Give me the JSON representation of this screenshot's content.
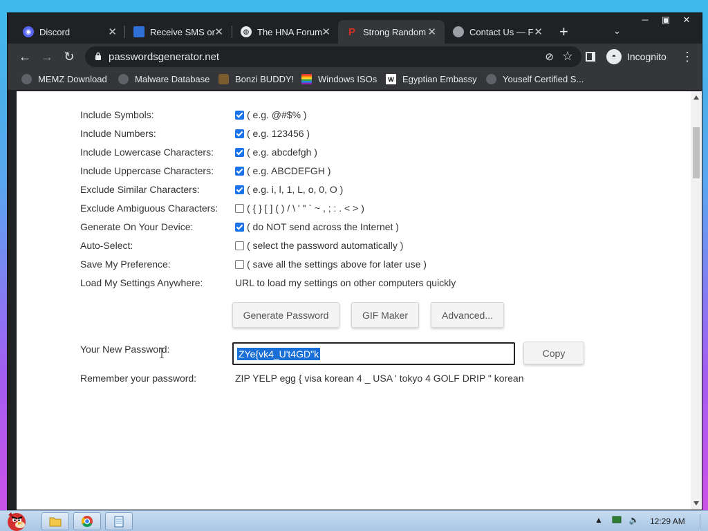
{
  "browser": {
    "tabs": [
      {
        "title": "Discord",
        "icon_color": "#5865f2",
        "icon": "discord-icon",
        "active": false
      },
      {
        "title": "Receive SMS or",
        "icon_color": "#2f6fd6",
        "icon": "sms-icon",
        "active": false
      },
      {
        "title": "The HNA Forum",
        "icon_color": "#e8eaed",
        "icon": "globe-icon",
        "active": false
      },
      {
        "title": "Strong Random",
        "icon_color": "#d93025",
        "icon": "password-icon",
        "active": true
      },
      {
        "title": "Contact Us — F",
        "icon_color": "#9aa0a6",
        "icon": "contact-icon",
        "active": false
      }
    ],
    "url": "passwordsgenerator.net",
    "profile_label": "Incognito",
    "bookmarks": [
      {
        "label": "MEMZ Download",
        "icon": "globe-icon"
      },
      {
        "label": "Malware Database",
        "icon": "globe-icon"
      },
      {
        "label": "Bonzi BUDDY!",
        "icon": "bonzi-icon"
      },
      {
        "label": "Windows ISOs",
        "icon": "rainbow-flag-icon"
      },
      {
        "label": "Egyptian Embassy",
        "icon": "wix-icon"
      },
      {
        "label": "Youself Certified S...",
        "icon": "globe-icon"
      }
    ]
  },
  "options": [
    {
      "label": "Include Symbols:",
      "checked": true,
      "hint": "( e.g. @#$% )"
    },
    {
      "label": "Include Numbers:",
      "checked": true,
      "hint": "( e.g. 123456 )"
    },
    {
      "label": "Include Lowercase Characters:",
      "checked": true,
      "hint": "( e.g. abcdefgh )"
    },
    {
      "label": "Include Uppercase Characters:",
      "checked": true,
      "hint": "( e.g. ABCDEFGH )"
    },
    {
      "label": "Exclude Similar Characters:",
      "checked": true,
      "hint": "( e.g. i, l, 1, L, o, 0, O )"
    },
    {
      "label": "Exclude Ambiguous Characters:",
      "checked": false,
      "hint": "( { } [ ] ( ) / \\ ' \" ` ~ , ; : . < > )"
    },
    {
      "label": "Generate On Your Device:",
      "checked": true,
      "hint": "( do NOT send across the Internet )"
    },
    {
      "label": "Auto-Select:",
      "checked": false,
      "hint": "( select the password automatically )"
    },
    {
      "label": "Save My Preference:",
      "checked": false,
      "hint": "( save all the settings above for later use )"
    }
  ],
  "load_settings": {
    "label": "Load My Settings Anywhere:",
    "text": "URL to load my settings on other computers quickly"
  },
  "buttons": {
    "generate": "Generate Password",
    "gif": "GIF Maker",
    "advanced": "Advanced...",
    "copy": "Copy"
  },
  "password": {
    "label": "Your New Password:",
    "value": "ZYe{vk4_U't4GD\"k"
  },
  "remember": {
    "label": "Remember your password:",
    "phrase": "ZIP YELP egg { visa korean 4 _ USA ' tokyo 4 GOLF DRIP \" korean"
  },
  "taskbar": {
    "clock": "12:29 AM"
  },
  "colors": {
    "checkbox_checked": "#1a73e8",
    "selection": "#1a6fd6",
    "chrome_dark": "#202124",
    "chrome_toolbar": "#35363a"
  }
}
